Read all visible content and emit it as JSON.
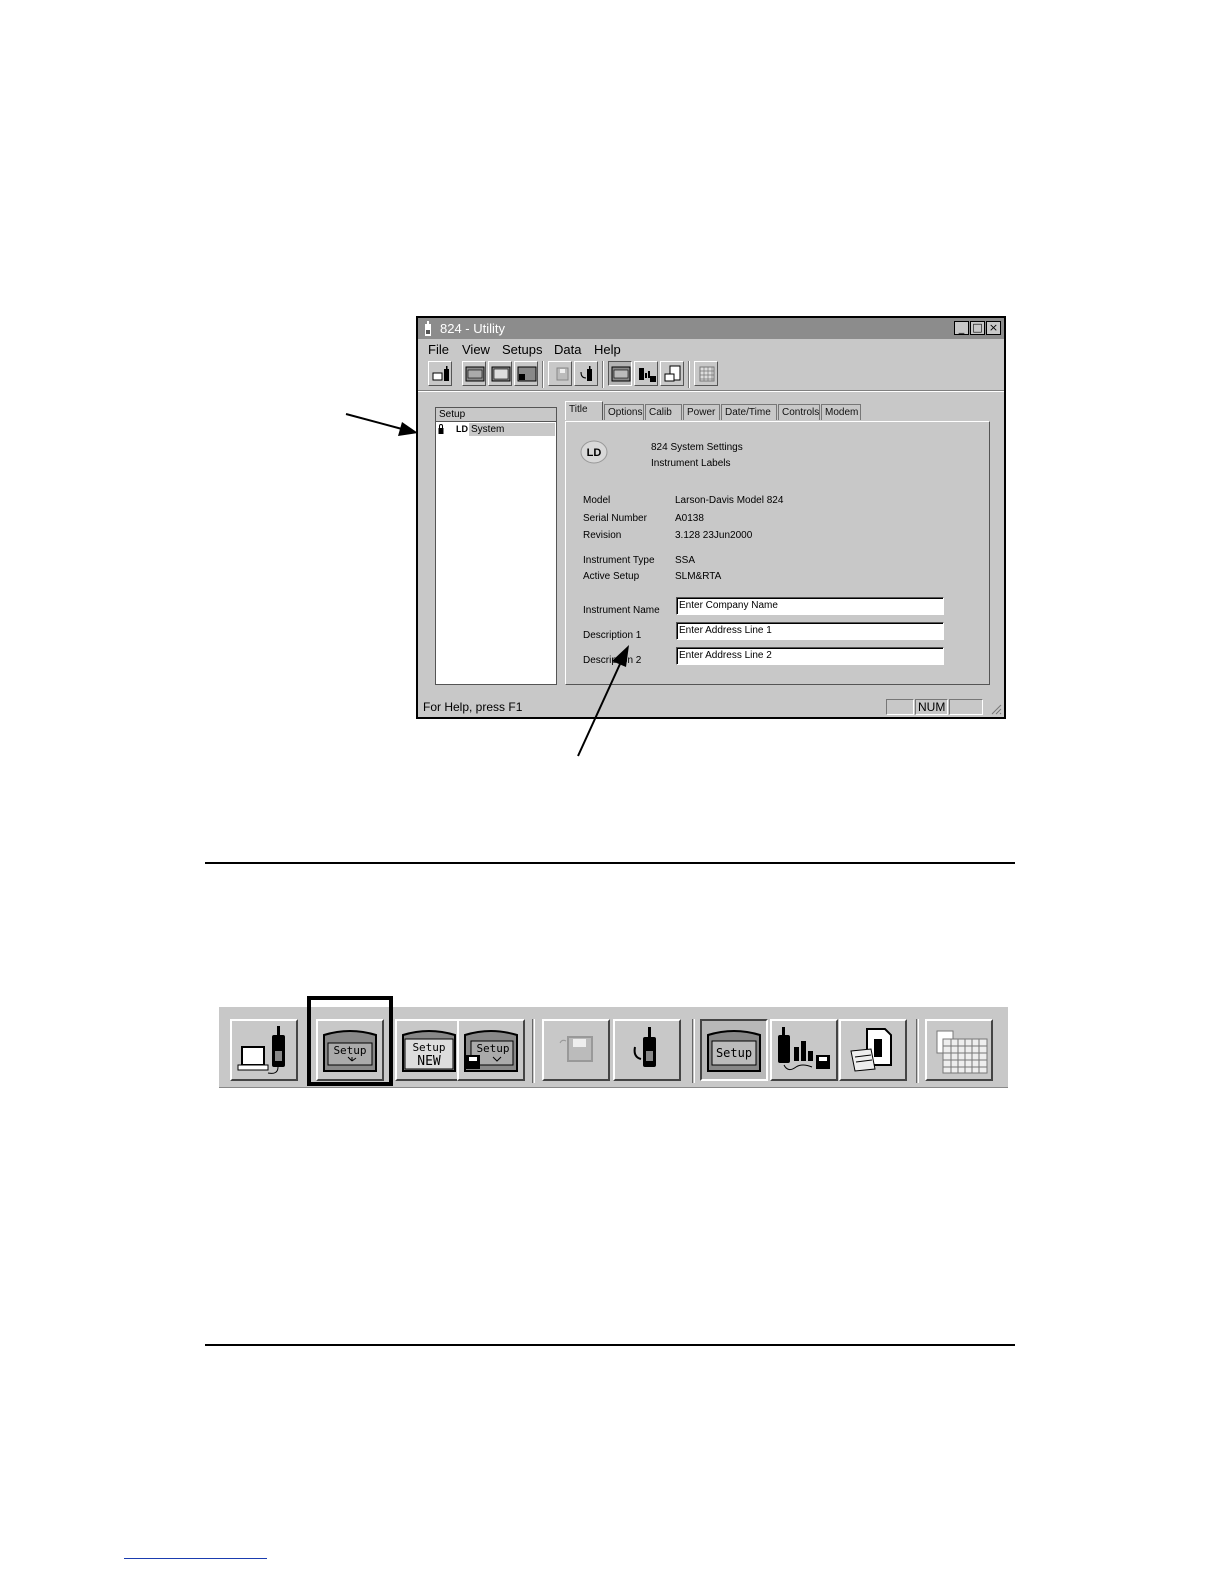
{
  "window": {
    "title": "824 - Utility",
    "controls": {
      "minimize": "_",
      "maximize": "□",
      "close": "×"
    }
  },
  "menu": [
    "File",
    "View",
    "Setups",
    "Data",
    "Help"
  ],
  "toolbar_icons": [
    "meter-connect-icon",
    "setup-download-icon",
    "setup-new-icon",
    "setup-save-icon",
    "save-disk-icon",
    "meter-upload-icon",
    "setup-active-icon",
    "meter-data-save-icon",
    "document-icon",
    "spreadsheet-icon"
  ],
  "tree": {
    "header": "Setup",
    "item": "System",
    "item_logo": "LD"
  },
  "tabs": [
    "Title",
    "Options",
    "Calib",
    "Power",
    "Date/Time",
    "Controls",
    "Modem"
  ],
  "active_tab": "Title",
  "panel": {
    "logo": "LD",
    "heading1": "824 System Settings",
    "heading2": "Instrument Labels",
    "fields": [
      {
        "label": "Model",
        "value": "Larson-Davis Model 824"
      },
      {
        "label": "Serial Number",
        "value": "A0138"
      },
      {
        "label": "Revision",
        "value": "3.128 23Jun2000"
      },
      {
        "label": "Instrument Type",
        "value": "SSA"
      },
      {
        "label": "Active Setup",
        "value": "SLM&RTA"
      }
    ],
    "inputs": [
      {
        "label": "Instrument Name",
        "value": "Enter Company Name"
      },
      {
        "label": "Description 1",
        "value": "Enter Address Line 1"
      },
      {
        "label": "Description 2",
        "value": "Enter Address Line 2"
      }
    ]
  },
  "status": {
    "help": "For Help, press F1",
    "num": "NUM"
  },
  "big_toolbar": {
    "labels": {
      "setup": "Setup",
      "new": "NEW"
    }
  }
}
